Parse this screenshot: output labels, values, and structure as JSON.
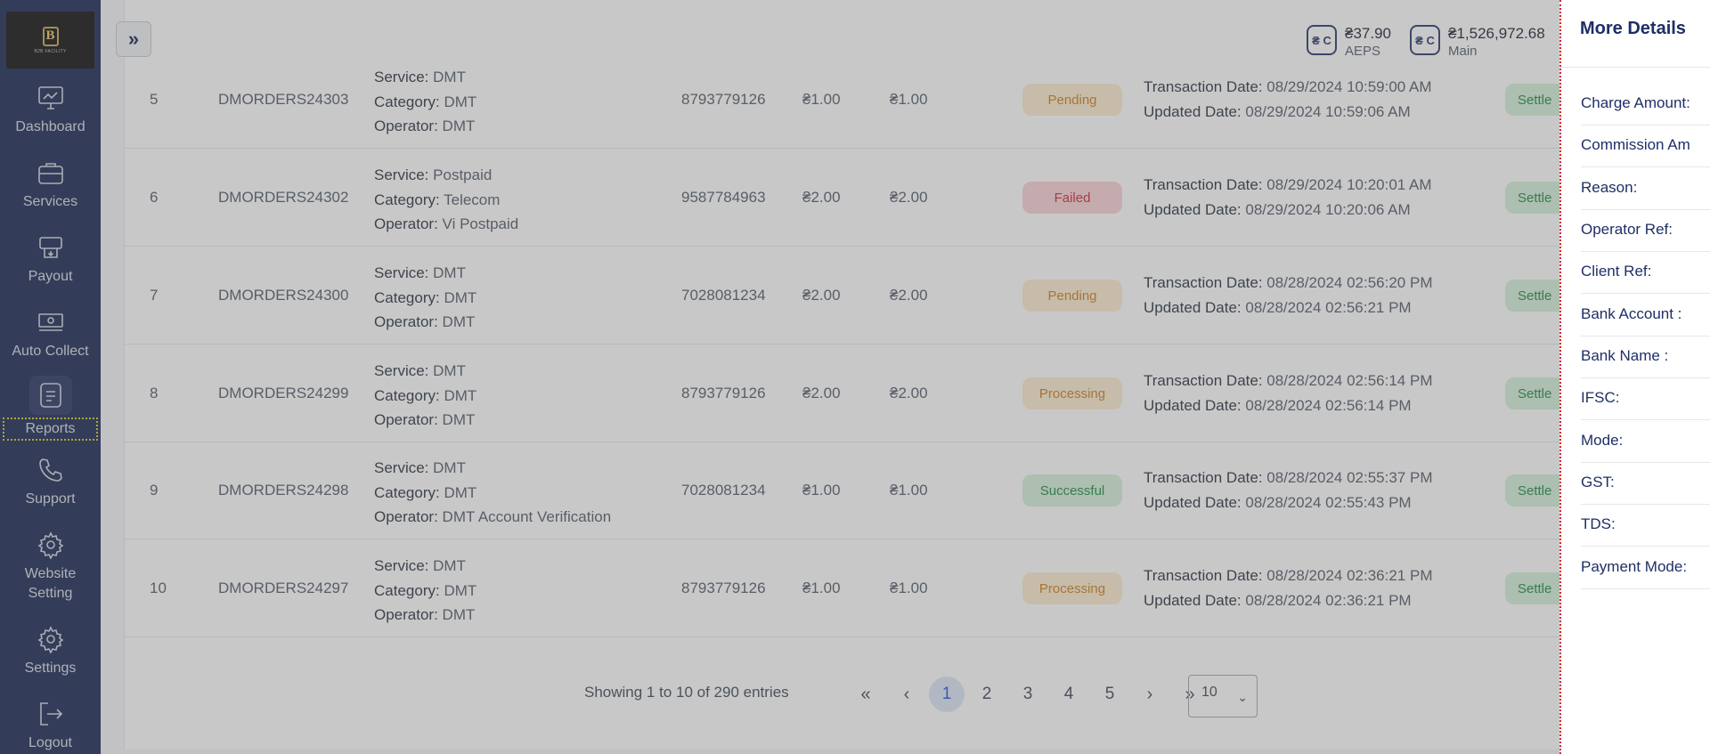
{
  "sidebar": {
    "logo_mark": "B",
    "logo_tag": "B2B FACILITY",
    "items": [
      {
        "label": "Dashboard",
        "icon": "dashboard-icon"
      },
      {
        "label": "Services",
        "icon": "briefcase-icon"
      },
      {
        "label": "Payout",
        "icon": "payout-icon"
      },
      {
        "label": "Auto Collect",
        "icon": "cash-icon"
      },
      {
        "label": "Reports",
        "icon": "report-icon",
        "active": true
      },
      {
        "label": "Support",
        "icon": "phone-icon"
      },
      {
        "label": "Website Setting",
        "icon": "gear-icon"
      },
      {
        "label": "Settings",
        "icon": "gear-icon"
      },
      {
        "label": "Logout",
        "icon": "logout-icon"
      }
    ]
  },
  "header": {
    "expand_icon": "»",
    "wallets": [
      {
        "icon": "wallet-icon",
        "symbol": "₴ C",
        "amount": "₴37.90",
        "label": "AEPS"
      },
      {
        "icon": "wallet-icon",
        "symbol": "₴ C",
        "amount": "₴1,526,972.68",
        "label": "Main"
      }
    ]
  },
  "labels": {
    "service": "Service:",
    "category": "Category:",
    "operator": "Operator:",
    "transaction_date": "Transaction Date:",
    "updated_date": "Updated Date:"
  },
  "rows": [
    {
      "num": "5",
      "order_id": "DMORDERS24303",
      "service": "DMT",
      "category": "DMT",
      "operator": "DMT",
      "mobile": "8793779126",
      "amount": "₴1.00",
      "amount2": "₴1.00",
      "status": "Pending",
      "status_class": "st-pending",
      "txn_date": "08/29/2024 10:59:00 AM",
      "upd_date": "08/29/2024 10:59:06 AM",
      "settlement": "Settle"
    },
    {
      "num": "6",
      "order_id": "DMORDERS24302",
      "service": "Postpaid",
      "category": "Telecom",
      "operator": "Vi Postpaid",
      "mobile": "9587784963",
      "amount": "₴2.00",
      "amount2": "₴2.00",
      "status": "Failed",
      "status_class": "st-failed",
      "txn_date": "08/29/2024 10:20:01 AM",
      "upd_date": "08/29/2024 10:20:06 AM",
      "settlement": "Settle"
    },
    {
      "num": "7",
      "order_id": "DMORDERS24300",
      "service": "DMT",
      "category": "DMT",
      "operator": "DMT",
      "mobile": "7028081234",
      "amount": "₴2.00",
      "amount2": "₴2.00",
      "status": "Pending",
      "status_class": "st-pending",
      "txn_date": "08/28/2024 02:56:20 PM",
      "upd_date": "08/28/2024 02:56:21 PM",
      "settlement": "Settle"
    },
    {
      "num": "8",
      "order_id": "DMORDERS24299",
      "service": "DMT",
      "category": "DMT",
      "operator": "DMT",
      "mobile": "8793779126",
      "amount": "₴2.00",
      "amount2": "₴2.00",
      "status": "Processing",
      "status_class": "st-processing",
      "txn_date": "08/28/2024 02:56:14 PM",
      "upd_date": "08/28/2024 02:56:14 PM",
      "settlement": "Settle"
    },
    {
      "num": "9",
      "order_id": "DMORDERS24298",
      "service": "DMT",
      "category": "DMT",
      "operator": "DMT Account Verification",
      "mobile": "7028081234",
      "amount": "₴1.00",
      "amount2": "₴1.00",
      "status": "Successful",
      "status_class": "st-successful",
      "txn_date": "08/28/2024 02:55:37 PM",
      "upd_date": "08/28/2024 02:55:43 PM",
      "settlement": "Settle"
    },
    {
      "num": "10",
      "order_id": "DMORDERS24297",
      "service": "DMT",
      "category": "DMT",
      "operator": "DMT",
      "mobile": "8793779126",
      "amount": "₴1.00",
      "amount2": "₴1.00",
      "status": "Processing",
      "status_class": "st-processing",
      "txn_date": "08/28/2024 02:36:21 PM",
      "upd_date": "08/28/2024 02:36:21 PM",
      "settlement": "Settle"
    }
  ],
  "pagination": {
    "info": "Showing 1 to 10 of 290 entries",
    "first": "«",
    "prev": "‹",
    "pages": [
      "1",
      "2",
      "3",
      "4",
      "5"
    ],
    "active_page": "1",
    "next": "›",
    "last": "»",
    "page_size": "10"
  },
  "drawer": {
    "title": "More Details",
    "fields": [
      "Charge Amount:",
      "Commission Am",
      "Reason:",
      "Operator Ref:",
      "Client Ref:",
      "Bank Account :",
      "Bank Name :",
      "IFSC:",
      "Mode:",
      "GST:",
      "TDS:",
      "Payment Mode:"
    ]
  }
}
